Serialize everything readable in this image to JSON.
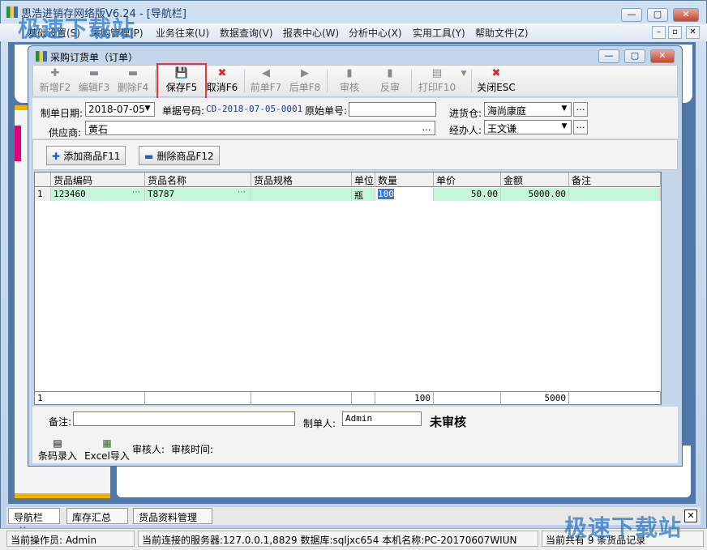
{
  "main": {
    "title": "思浩进销存网络版V6.24 - [导航栏]",
    "menu": [
      "基础设置(S)",
      "采购管理(P)",
      "业务往来(U)",
      "数据查询(V)",
      "报表中心(W)",
      "分析中心(X)",
      "实用工具(Y)",
      "帮助文件(Z)"
    ],
    "win_minimize": "—",
    "win_restore": "▢",
    "win_close": "✕"
  },
  "dialog": {
    "title": "采购订货单（订单）",
    "toolbar": {
      "add": "新增F2",
      "edit": "编辑F3",
      "delete": "删除F4",
      "save": "保存F5",
      "cancel": "取消F6",
      "prev": "前单F7",
      "next": "后单F8",
      "audit": "审核",
      "unaudit": "反审",
      "print": "打印F10",
      "close": "关闭ESC"
    },
    "form": {
      "date_label": "制单日期:",
      "date_value": "2018-07-05",
      "billno_label": "单据号码:",
      "billno_value": "CD-2018-07-05-0001",
      "orig_label": "原始单号:",
      "orig_value": "",
      "warehouse_label": "进货仓:",
      "warehouse_value": "海尚康庭",
      "supplier_label": "供应商:",
      "supplier_value": "黄石",
      "handler_label": "经办人:",
      "handler_value": "王文谦"
    },
    "actions": {
      "add_item": "添加商品F11",
      "del_item": "删除商品F12"
    },
    "grid": {
      "headers": [
        "货品编码",
        "货品名称",
        "货品规格",
        "单位",
        "数量",
        "单价",
        "金额",
        "备注"
      ],
      "row": {
        "no": "1",
        "code": "123460",
        "name": "T8787",
        "spec": "",
        "unit": "瓶",
        "qty": "100",
        "price": "50.00",
        "amount": "5000.00",
        "remark": ""
      },
      "footer": {
        "count": "1",
        "qty": "100",
        "amount": "5000"
      }
    },
    "bottom": {
      "remark_label": "备注:",
      "remark_value": "",
      "maker_label": "制单人:",
      "maker_value": "Admin",
      "status": "未审核",
      "barcode": "条码录入",
      "excel": "Excel导入",
      "auditor_label": "审核人:",
      "audit_time_label": "审核时间:"
    }
  },
  "tabs": [
    "导航栏",
    "库存汇总",
    "货品资料管理"
  ],
  "status": {
    "operator": "当前操作员: Admin",
    "server": "当前连接的服务器:127.0.0.1,8829 数据库:sqljxc654 本机名称:PC-20170607WIUN",
    "records": "当前共有 9 条货品记录"
  },
  "watermark": "极速下载站"
}
